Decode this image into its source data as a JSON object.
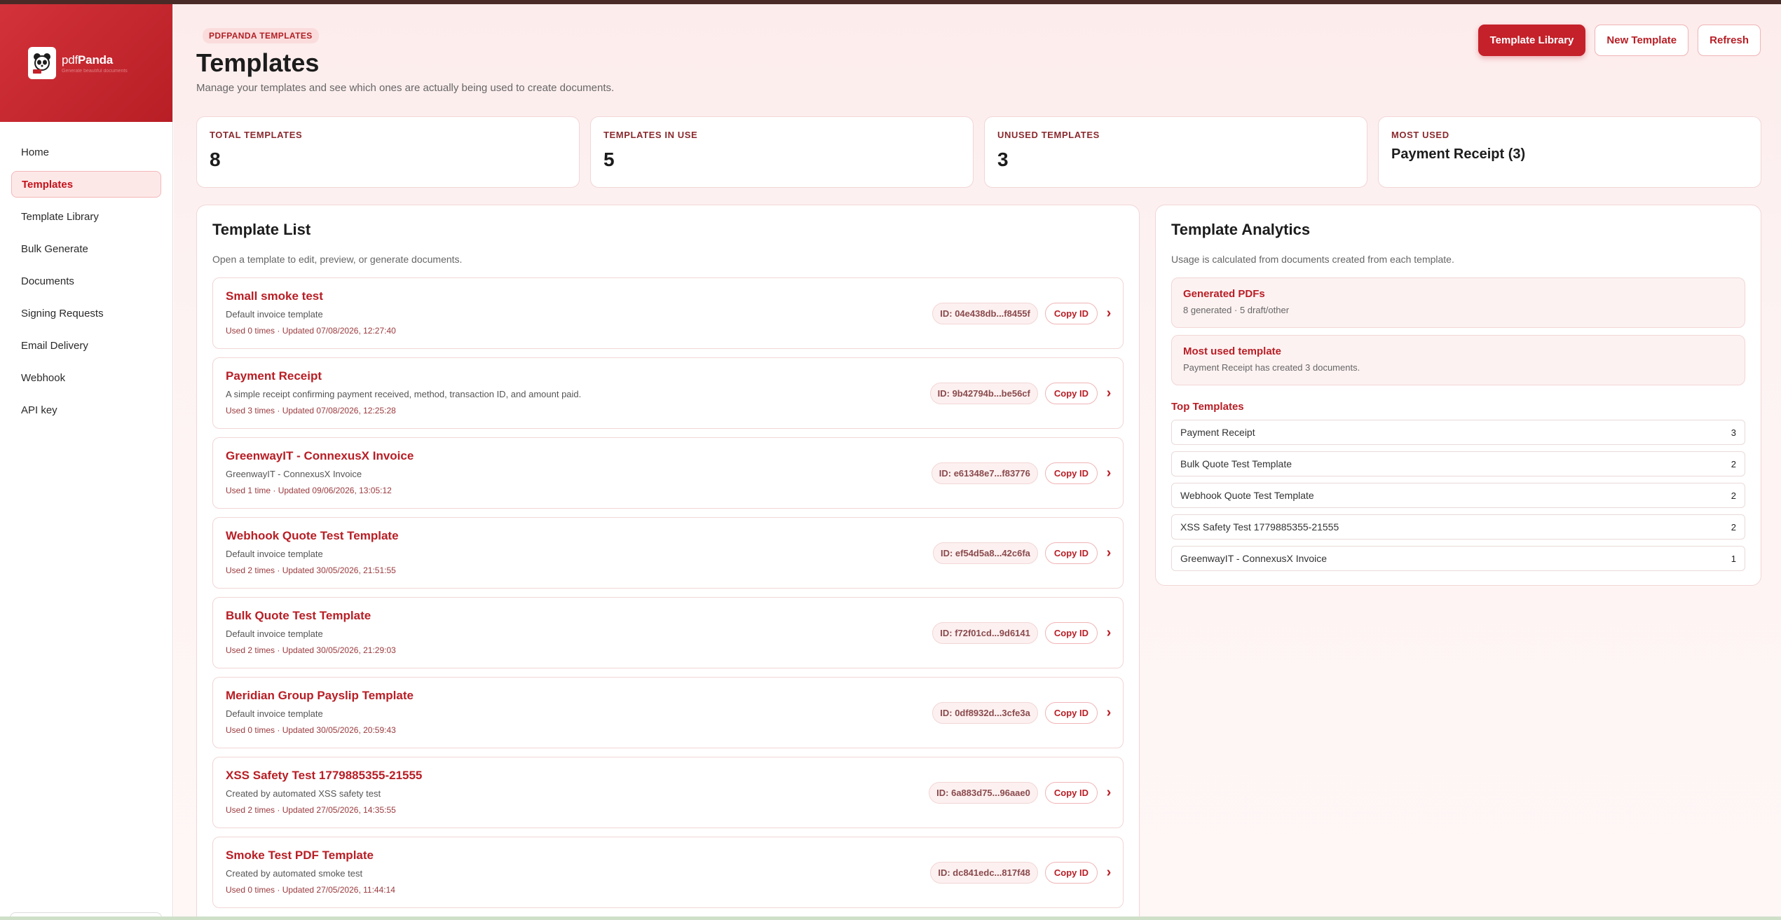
{
  "brand": {
    "name_prefix": "pdf",
    "name_suffix": "Panda",
    "tagline": "Generate beautiful documents",
    "colors": {
      "primary": "#c4212a",
      "primary_dark": "#b81e25"
    }
  },
  "sidebar": {
    "items": [
      {
        "label": "Home",
        "active": false
      },
      {
        "label": "Templates",
        "active": true
      },
      {
        "label": "Template Library",
        "active": false
      },
      {
        "label": "Bulk Generate",
        "active": false
      },
      {
        "label": "Documents",
        "active": false
      },
      {
        "label": "Signing Requests",
        "active": false
      },
      {
        "label": "Email Delivery",
        "active": false
      },
      {
        "label": "Webhook",
        "active": false
      },
      {
        "label": "API key",
        "active": false
      }
    ]
  },
  "header": {
    "eyebrow": "PDFPANDA TEMPLATES",
    "title": "Templates",
    "subtitle": "Manage your templates and see which ones are actually being used to create documents.",
    "actions": {
      "library": "Template Library",
      "new": "New Template",
      "refresh": "Refresh"
    }
  },
  "stats": [
    {
      "label": "TOTAL TEMPLATES",
      "value": "8"
    },
    {
      "label": "TEMPLATES IN USE",
      "value": "5"
    },
    {
      "label": "UNUSED TEMPLATES",
      "value": "3"
    },
    {
      "label": "MOST USED",
      "value": "Payment Receipt (3)"
    }
  ],
  "template_list": {
    "title": "Template List",
    "subtitle": "Open a template to edit, preview, or generate documents.",
    "copy_label": "Copy ID",
    "items": [
      {
        "name": "Small smoke test",
        "description": "Default invoice template",
        "meta": "Used 0 times · Updated 07/08/2026, 12:27:40",
        "id": "ID: 04e438db...f8455f"
      },
      {
        "name": "Payment Receipt",
        "description": "A simple receipt confirming payment received, method, transaction ID, and amount paid.",
        "meta": "Used 3 times · Updated 07/08/2026, 12:25:28",
        "id": "ID: 9b42794b...be56cf"
      },
      {
        "name": "GreenwayIT - ConnexusX Invoice",
        "description": "GreenwayIT - ConnexusX Invoice",
        "meta": "Used 1 time · Updated 09/06/2026, 13:05:12",
        "id": "ID: e61348e7...f83776"
      },
      {
        "name": "Webhook Quote Test Template",
        "description": "Default invoice template",
        "meta": "Used 2 times · Updated 30/05/2026, 21:51:55",
        "id": "ID: ef54d5a8...42c6fa"
      },
      {
        "name": "Bulk Quote Test Template",
        "description": "Default invoice template",
        "meta": "Used 2 times · Updated 30/05/2026, 21:29:03",
        "id": "ID: f72f01cd...9d6141"
      },
      {
        "name": "Meridian Group Payslip Template",
        "description": "Default invoice template",
        "meta": "Used 0 times · Updated 30/05/2026, 20:59:43",
        "id": "ID: 0df8932d...3cfe3a"
      },
      {
        "name": "XSS Safety Test 1779885355-21555",
        "description": "Created by automated XSS safety test",
        "meta": "Used 2 times · Updated 27/05/2026, 14:35:55",
        "id": "ID: 6a883d75...96aae0"
      },
      {
        "name": "Smoke Test PDF Template",
        "description": "Created by automated smoke test",
        "meta": "Used 0 times · Updated 27/05/2026, 11:44:14",
        "id": "ID: dc841edc...817f48"
      }
    ]
  },
  "analytics": {
    "title": "Template Analytics",
    "subtitle": "Usage is calculated from documents created from each template.",
    "generated": {
      "title": "Generated PDFs",
      "text": "8 generated · 5 draft/other"
    },
    "most_used": {
      "title": "Most used template",
      "text": "Payment Receipt has created 3 documents."
    },
    "top_title": "Top Templates",
    "top": [
      {
        "name": "Payment Receipt",
        "count": "3"
      },
      {
        "name": "Bulk Quote Test Template",
        "count": "2"
      },
      {
        "name": "Webhook Quote Test Template",
        "count": "2"
      },
      {
        "name": "XSS Safety Test 1779885355-21555",
        "count": "2"
      },
      {
        "name": "GreenwayIT - ConnexusX Invoice",
        "count": "1"
      }
    ]
  }
}
